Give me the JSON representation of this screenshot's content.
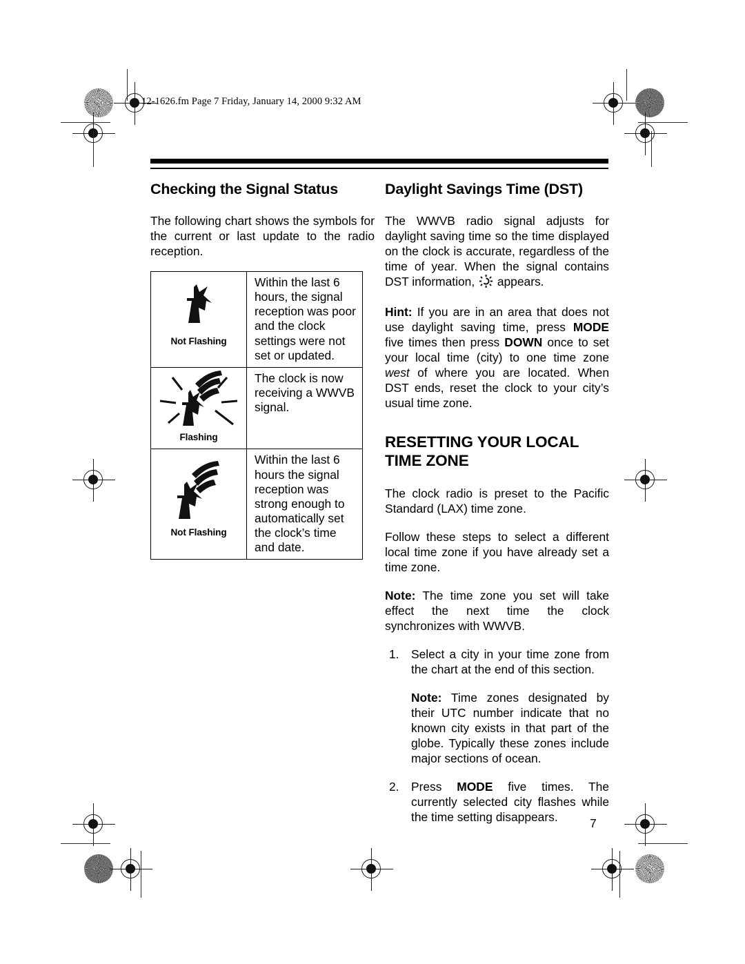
{
  "header": {
    "file_line": "12-1626.fm  Page 7  Friday, January 14, 2000  9:32 AM"
  },
  "left_column": {
    "heading": "Checking the Signal Status",
    "intro": "The following chart shows the symbols for the current or last update to the radio reception."
  },
  "signal_table": {
    "rows": [
      {
        "icon": "antenna-tower-no-signal-icon",
        "flash_label": "Not Flashing",
        "description": "Within the last 6 hours, the signal reception was poor and the clock settings were not set or updated."
      },
      {
        "icon": "antenna-tower-receiving-flashing-icon",
        "flash_label": "Flashing",
        "description": "The clock is now receiving a WWVB signal."
      },
      {
        "icon": "antenna-tower-strong-signal-icon",
        "flash_label": "Not Flashing",
        "description": "Within the last 6 hours the signal reception was strong enough to automatically set the clock’s time and date."
      }
    ]
  },
  "right_column": {
    "dst_heading": "Daylight Savings Time (DST)",
    "dst_para_before_icon": "The WWVB radio signal adjusts for daylight saving time so the time displayed on the clock is accurate, regardless of the time of year. When the signal contains DST information, ",
    "dst_icon_name": "dst-sun-icon",
    "dst_para_after_icon": " appears.",
    "hint_label": "Hint:",
    "hint_part1": " If you are in an area that does not use daylight saving time, press ",
    "hint_mode": "MODE",
    "hint_part2": " five times then press ",
    "hint_down": "DOWN",
    "hint_part3": " once to set your local time (city) to one time zone ",
    "hint_west": "west",
    "hint_part4": " of where you are located. When DST ends, reset the clock to your city’s usual time zone.",
    "resetting_heading": "Resetting Your Local Time Zone",
    "preset_para": "The clock radio is preset to the Pacific Standard (LAX) time zone.",
    "follow_para": "Follow these steps to select a different local time zone if you have already set a time zone.",
    "note_label": "Note:",
    "note_text": " The time zone you set will take effect the next time the clock synchronizes with WWVB.",
    "steps": [
      {
        "number": "1.",
        "text": "Select a city in your time zone from the chart at the end of this section.",
        "subnote_label": "Note:",
        "subnote_text": " Time zones designated by their UTC number indicate that no known city exists in that part of the globe. Typically these zones include major sections of ocean."
      },
      {
        "number": "2.",
        "text_part1": "Press ",
        "text_bold": "MODE",
        "text_part2": " five times. The currently selected city flashes while the time setting disappears."
      }
    ]
  },
  "footer": {
    "page_number": "7"
  }
}
